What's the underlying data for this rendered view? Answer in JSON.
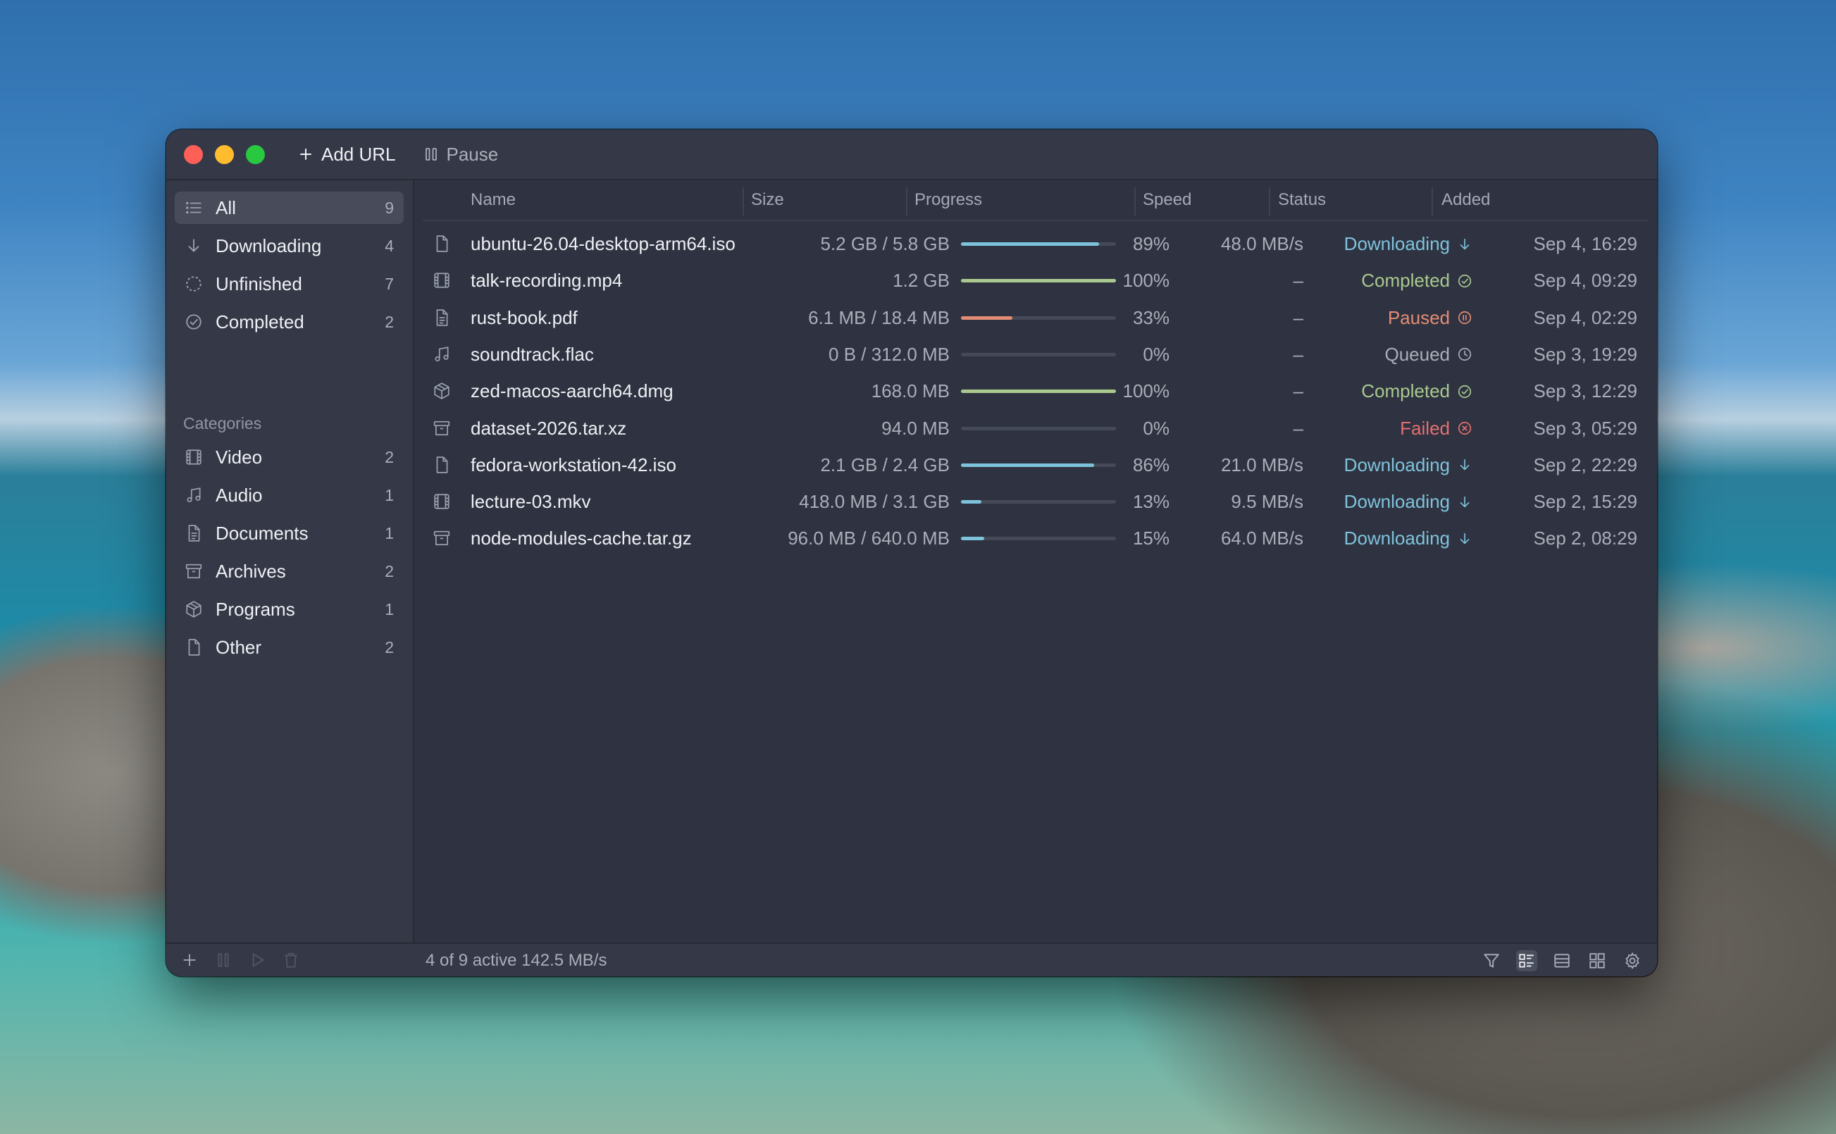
{
  "toolbar": {
    "add_url_label": "Add URL",
    "pause_label": "Pause"
  },
  "sidebar": {
    "filters": [
      {
        "label": "All",
        "count": "9",
        "icon": "list-icon",
        "active": true
      },
      {
        "label": "Downloading",
        "count": "4",
        "icon": "arrow-down-icon"
      },
      {
        "label": "Unfinished",
        "count": "7",
        "icon": "dashed-circle-icon"
      },
      {
        "label": "Completed",
        "count": "2",
        "icon": "check-circle-icon"
      }
    ],
    "categories_heading": "Categories",
    "categories": [
      {
        "label": "Video",
        "count": "2",
        "icon": "film-icon"
      },
      {
        "label": "Audio",
        "count": "1",
        "icon": "music-note-icon"
      },
      {
        "label": "Documents",
        "count": "1",
        "icon": "document-icon"
      },
      {
        "label": "Archives",
        "count": "2",
        "icon": "archive-box-icon"
      },
      {
        "label": "Programs",
        "count": "1",
        "icon": "package-icon"
      },
      {
        "label": "Other",
        "count": "2",
        "icon": "file-icon"
      }
    ]
  },
  "table": {
    "columns": [
      "Name",
      "Size",
      "Progress",
      "Speed",
      "Status",
      "Added"
    ],
    "rows": [
      {
        "icon": "file-icon",
        "name": "ubuntu-26.04-desktop-arm64.iso",
        "size": "5.2 GB / 5.8 GB",
        "progress": 0.89,
        "percent": "89%",
        "speed": "48.0 MB/s",
        "status": "Downloading",
        "status_icon": "arrow-down-icon",
        "added": "Sep 4, 16:29"
      },
      {
        "icon": "film-icon",
        "name": "talk-recording.mp4",
        "size": "1.2 GB",
        "progress": 1.0,
        "percent": "100%",
        "speed": "–",
        "status": "Completed",
        "status_icon": "check-circle-icon",
        "added": "Sep 4, 09:29"
      },
      {
        "icon": "document-icon",
        "name": "rust-book.pdf",
        "size": "6.1 MB / 18.4 MB",
        "progress": 0.33,
        "percent": "33%",
        "speed": "–",
        "status": "Paused",
        "status_icon": "pause-circle-icon",
        "added": "Sep 4, 02:29"
      },
      {
        "icon": "music-note-icon",
        "name": "soundtrack.flac",
        "size": "0 B / 312.0 MB",
        "progress": 0.0,
        "percent": "0%",
        "speed": "–",
        "status": "Queued",
        "status_icon": "clock-icon",
        "added": "Sep 3, 19:29"
      },
      {
        "icon": "package-icon",
        "name": "zed-macos-aarch64.dmg",
        "size": "168.0 MB",
        "progress": 1.0,
        "percent": "100%",
        "speed": "–",
        "status": "Completed",
        "status_icon": "check-circle-icon",
        "added": "Sep 3, 12:29"
      },
      {
        "icon": "archive-box-icon",
        "name": "dataset-2026.tar.xz",
        "size": "94.0 MB",
        "progress": 0.0,
        "percent": "0%",
        "speed": "–",
        "status": "Failed",
        "status_icon": "x-circle-icon",
        "added": "Sep 3, 05:29"
      },
      {
        "icon": "file-icon",
        "name": "fedora-workstation-42.iso",
        "size": "2.1 GB / 2.4 GB",
        "progress": 0.86,
        "percent": "86%",
        "speed": "21.0 MB/s",
        "status": "Downloading",
        "status_icon": "arrow-down-icon",
        "added": "Sep 2, 22:29"
      },
      {
        "icon": "film-icon",
        "name": "lecture-03.mkv",
        "size": "418.0 MB / 3.1 GB",
        "progress": 0.13,
        "percent": "13%",
        "speed": "9.5 MB/s",
        "status": "Downloading",
        "status_icon": "arrow-down-icon",
        "added": "Sep 2, 15:29"
      },
      {
        "icon": "archive-box-icon",
        "name": "node-modules-cache.tar.gz",
        "size": "96.0 MB / 640.0 MB",
        "progress": 0.15,
        "percent": "15%",
        "speed": "64.0 MB/s",
        "status": "Downloading",
        "status_icon": "arrow-down-icon",
        "added": "Sep 2, 08:29"
      }
    ]
  },
  "status_colors": {
    "Downloading": "#7ec3dc",
    "Completed": "#a9c98e",
    "Paused": "#e38c73",
    "Queued": "#a9aeba",
    "Failed": "#e56f6f"
  },
  "bar_colors": {
    "Downloading": "#7ec3dc",
    "Completed": "#a9c98e",
    "Paused": "#e38c73",
    "Queued": "#454a57",
    "Failed": "#454a57"
  },
  "statusbar": {
    "summary": "4 of 9 active 142.5 MB/s"
  }
}
